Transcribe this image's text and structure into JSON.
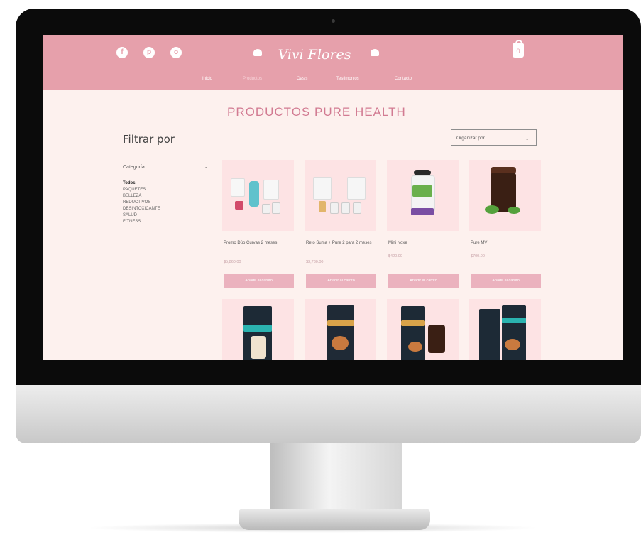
{
  "header": {
    "social": [
      "f",
      "p",
      "o"
    ],
    "logo": "Vivi Flores",
    "cart_count": "0",
    "nav": [
      {
        "label": "Inicio"
      },
      {
        "label": "Productos"
      },
      {
        "label": "Oasis"
      },
      {
        "label": "Testimonios"
      },
      {
        "label": "Contacto"
      }
    ]
  },
  "page_title": "PRODUCTOS PURE HEALTH",
  "sidebar": {
    "title": "Filtrar por",
    "category_label": "Categoría",
    "collapse_symbol": "-",
    "categories": [
      "Todos",
      "PAQUETES",
      "BELLEZA",
      "REDUCTIVOS",
      "DESINTOXICANTE",
      "SALUD",
      "FITNESS"
    ]
  },
  "sort": {
    "label": "Organizar por",
    "chevron": "⌄"
  },
  "products": [
    {
      "name": "Promo Dúo Curvas 2 meses",
      "price": "$5,860.00",
      "button": "Añadir al carrito"
    },
    {
      "name": "Reto Suma + Pure 2 para 2 meses",
      "price": "$3,730.00",
      "button": "Añadir al carrito"
    },
    {
      "name": "Mini Noxe",
      "price": "$420.00",
      "button": "Añadir al carrito"
    },
    {
      "name": "Pure MV",
      "price": "$700.00",
      "button": "Añadir al carrito"
    }
  ],
  "colors": {
    "header_pink": "#e6a0ab",
    "title_pink": "#d27b92",
    "page_bg": "#fdf1ee",
    "card_bg": "#fde3e4",
    "button_pink": "#ebb2be"
  }
}
